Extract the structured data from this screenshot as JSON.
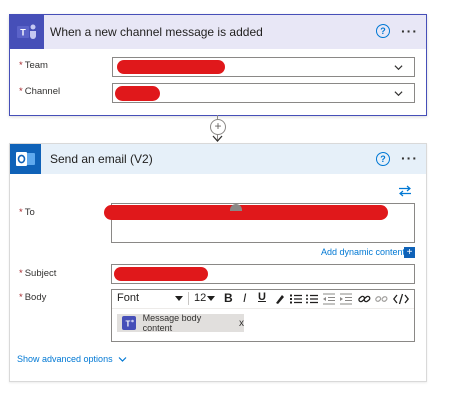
{
  "trigger": {
    "title": "When a new channel message is added",
    "fields": [
      {
        "label": "Team",
        "required_mark": "*"
      },
      {
        "label": "Channel",
        "required_mark": "*"
      }
    ],
    "help_icon": "?",
    "more_icon": "···"
  },
  "connector": {
    "add_icon": "+"
  },
  "action": {
    "title": "Send an email (V2)",
    "help_icon": "?",
    "more_icon": "···",
    "to_label": "To",
    "subject_label": "Subject",
    "body_label": "Body",
    "required_mark": "*",
    "add_dynamic_content": "Add dynamic content",
    "add_dynamic_icon": "+",
    "toolbar": {
      "font": "Font",
      "size": "12",
      "bold": "B",
      "italic": "I",
      "underline": "U"
    },
    "token_label": "Message body content",
    "token_close": "x",
    "advanced_options": "Show advanced options"
  },
  "colors": {
    "teams": "#464fb8",
    "outlook": "#0f62b8",
    "link": "#0078d4",
    "required": "#a4262c",
    "redaction": "#e0181b"
  }
}
